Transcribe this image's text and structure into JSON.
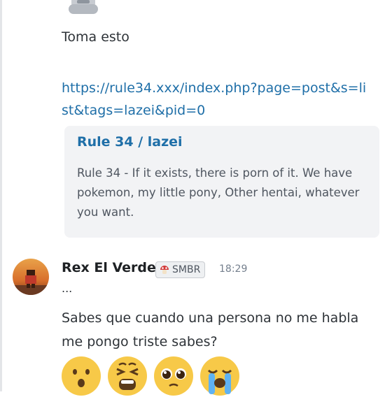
{
  "messages": {
    "first": {
      "text": "Toma esto",
      "link": "https://rule34.xxx/index.php?page=post&s=list&tags=lazei&pid=0",
      "embed": {
        "title": "Rule 34  / lazei",
        "description": "Rule 34 - If it exists, there is porn of it. We have pokemon, my little pony, Other hentai, whatever you want."
      }
    },
    "second": {
      "author": "Rex El Verde",
      "tag": "SMBR",
      "timestamp": "18:29",
      "ellipsis": "...",
      "text": "Sabes que cuando una persona no me habla me pongo triste sabes?",
      "emojis": [
        "hushed-face-emoji",
        "tired-face-emoji",
        "pleading-face-emoji",
        "crying-face-emoji"
      ]
    }
  },
  "colors": {
    "link": "#1f6fa8",
    "embed_bg": "#f2f3f5",
    "emoji_yellow": "#f7c948"
  }
}
